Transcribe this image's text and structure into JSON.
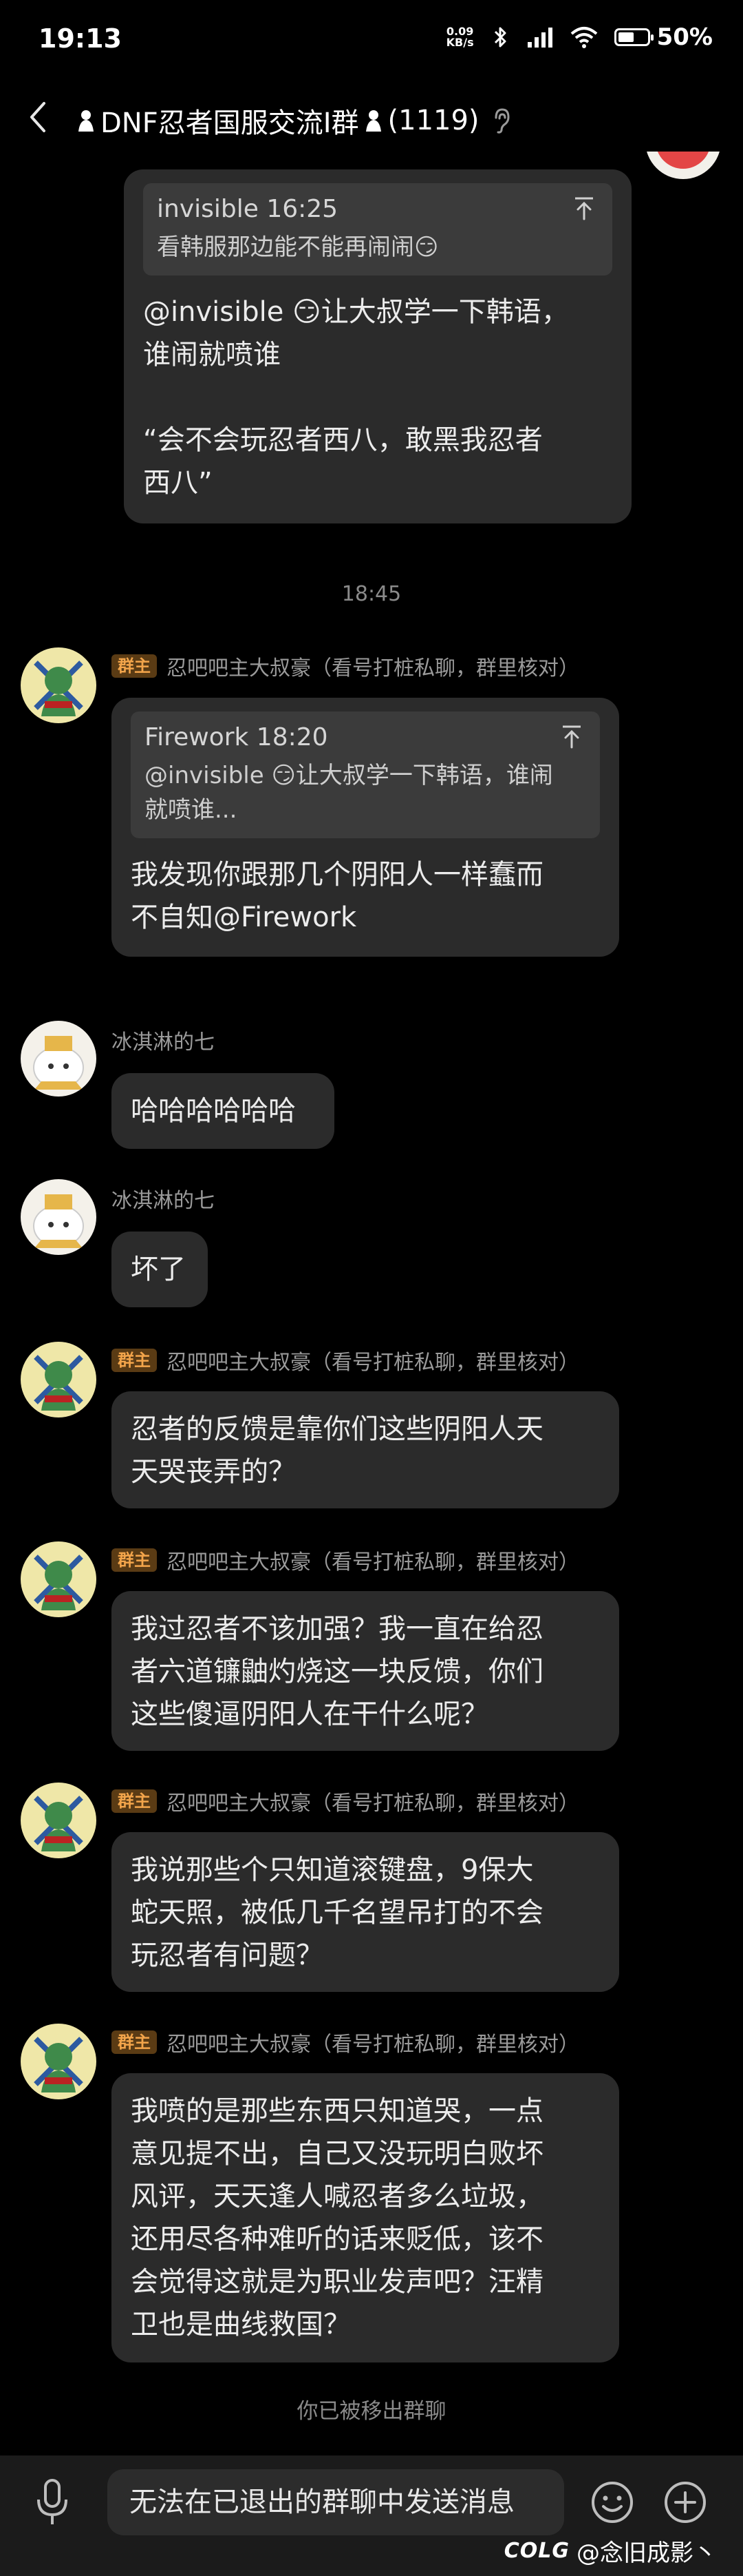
{
  "status_bar": {
    "time": "19:13",
    "net_speed_value": "0.09",
    "net_speed_unit": "KB/s",
    "battery": "50%"
  },
  "header": {
    "title": "DNF忍者国服交流I群",
    "member_count": "(1119)"
  },
  "messages": [
    {
      "quote": {
        "head": "invisible 16:25",
        "body": "看韩服那边能不能再闹闹😏"
      },
      "text": "@invisible 😏让大叔学一下韩语，\n谁闹就喷谁\n\n“会不会玩忍者西八，敢黑我忍者\n西八”"
    },
    {
      "time": "18:45"
    },
    {
      "sender": "忍吧吧主大叔豪（看号打桩私聊，群里核对）",
      "badge": "群主",
      "quote": {
        "head": "Firework 18:20",
        "body": "@invisible 😏让大叔学一下韩语，谁闹\n就喷谁..."
      },
      "text": "我发现你跟那几个阴阳人一样蠢而\n不自知@Firework"
    },
    {
      "sender": "冰淇淋的七",
      "text": "哈哈哈哈哈哈"
    },
    {
      "sender": "冰淇淋的七",
      "text": "坏了"
    },
    {
      "sender": "忍吧吧主大叔豪（看号打桩私聊，群里核对）",
      "badge": "群主",
      "text": "忍者的反馈是靠你们这些阴阳人天\n天哭丧弄的？"
    },
    {
      "sender": "忍吧吧主大叔豪（看号打桩私聊，群里核对）",
      "badge": "群主",
      "text": "我过忍者不该加强？我一直在给忍\n者六道镰鼬灼烧这一块反馈，你们\n这些傻逼阴阳人在干什么呢？"
    },
    {
      "sender": "忍吧吧主大叔豪（看号打桩私聊，群里核对）",
      "badge": "群主",
      "text": "我说那些个只知道滚键盘，9保大\n蛇天照，被低几千名望吊打的不会\n玩忍者有问题？"
    },
    {
      "sender": "忍吧吧主大叔豪（看号打桩私聊，群里核对）",
      "badge": "群主",
      "text": "我喷的是那些东西只知道哭，一点\n意见提不出，自己又没玩明白败坏\n风评，天天逢人喊忍者多么垃圾，\n还用尽各种难听的话来贬低，该不\n会觉得这就是为职业发声吧？汪精\n卫也是曲线救国？"
    }
  ],
  "removed_notice": "你已被移出群聊",
  "input": {
    "placeholder": "无法在已退出的群聊中发送消息"
  },
  "watermark": {
    "logo": "COLG",
    "user": "@念旧成影丶"
  },
  "colors": {
    "background": "#000000",
    "bubble": "#2b2b2b",
    "quote": "#3b3b3b",
    "badge_bg": "#5a3b14",
    "badge_text": "#f3a54b"
  }
}
